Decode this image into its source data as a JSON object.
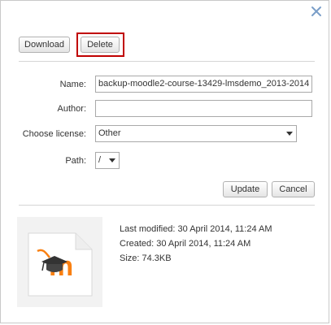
{
  "toolbar": {
    "download_label": "Download",
    "delete_label": "Delete"
  },
  "form": {
    "name_label": "Name:",
    "name_value": "backup-moodle2-course-13429-lmsdemo_2013-2014",
    "author_label": "Author:",
    "author_value": "",
    "license_label": "Choose license:",
    "license_value": "Other",
    "path_label": "Path:",
    "path_value": "/"
  },
  "actions": {
    "update_label": "Update",
    "cancel_label": "Cancel"
  },
  "fileinfo": {
    "last_modified": "Last modified: 30 April 2014, 11:24 AM",
    "created": "Created: 30 April 2014, 11:24 AM",
    "size": "Size: 74.3KB"
  },
  "icons": {
    "close": "close-icon",
    "file": "moodle-file-icon"
  },
  "colors": {
    "highlight": "#c00000",
    "moodle_orange": "#f98012"
  }
}
